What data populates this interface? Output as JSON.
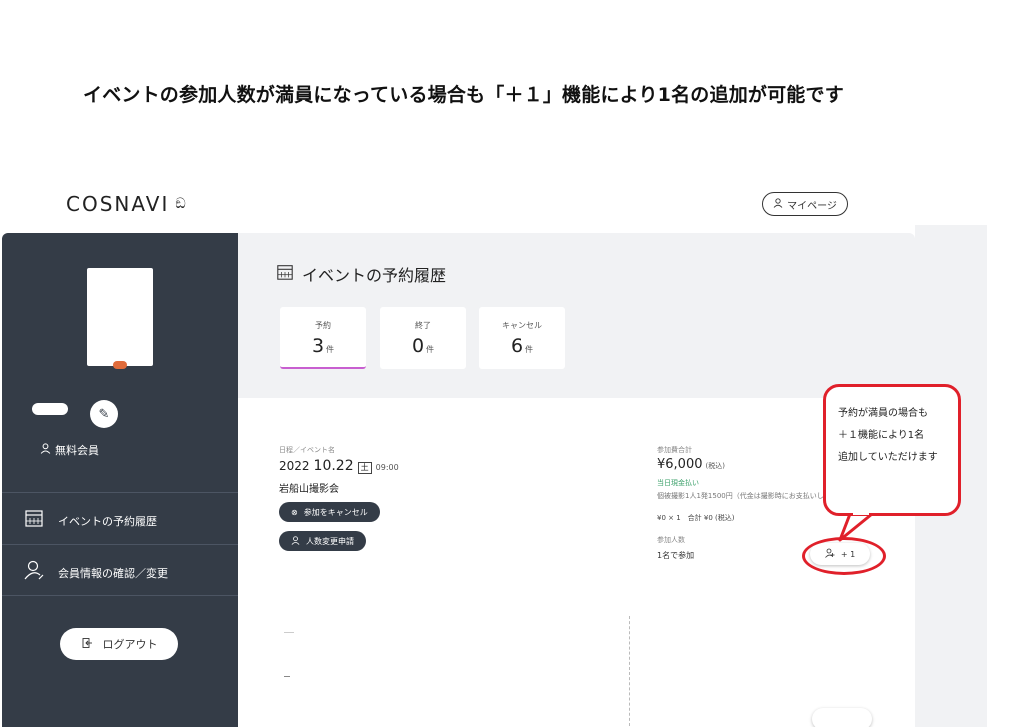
{
  "heading": "イベントの参加人数が満員になっている場合も「＋１」機能により1名の追加が可能です",
  "topbar": {
    "logo": "COSNAVI",
    "mypage_label": "マイページ"
  },
  "sidebar": {
    "member_type": "無料会員",
    "items": [
      {
        "label": "イベントの予約履歴",
        "icon": "calendar-icon"
      },
      {
        "label": "会員情報の確認／変更",
        "icon": "user-edit-icon"
      }
    ],
    "logout_label": "ログアウト"
  },
  "main": {
    "title": "イベントの予約履歴",
    "stats": [
      {
        "label": "予約",
        "count": "3",
        "unit": "件"
      },
      {
        "label": "終了",
        "count": "0",
        "unit": "件"
      },
      {
        "label": "キャンセル",
        "count": "6",
        "unit": "件"
      }
    ]
  },
  "event": {
    "date_label": "日程／イベント名",
    "year": "2022",
    "date": "10.22",
    "weekday": "土",
    "time": "09:00",
    "name": "岩船山撮影会",
    "cancel_label": "参加をキャンセル",
    "change_label": "人数変更申請",
    "fee_label": "参加費合計",
    "fee_amount": "¥6,000",
    "fee_tax": "(税込)",
    "payment_note": "当日現金払い",
    "fee_detail": "個被撮影1人1発1500円（代金は撮影時にお支払いします）",
    "fee_sum": "¥0 × 1　合計 ¥0 (税込)",
    "participants_label": "参加人数",
    "participants_value": "1名で参加",
    "plus_label": "+ 1"
  },
  "callout": {
    "line1": "予約が満員の場合も",
    "line2": "＋１機能により1名",
    "line3": "追加していただけます"
  },
  "colors": {
    "sidebar_bg": "#343c47",
    "highlight_red": "#e0202a",
    "tab_accent": "#c85fd0",
    "payment_green": "#3ba06a"
  }
}
